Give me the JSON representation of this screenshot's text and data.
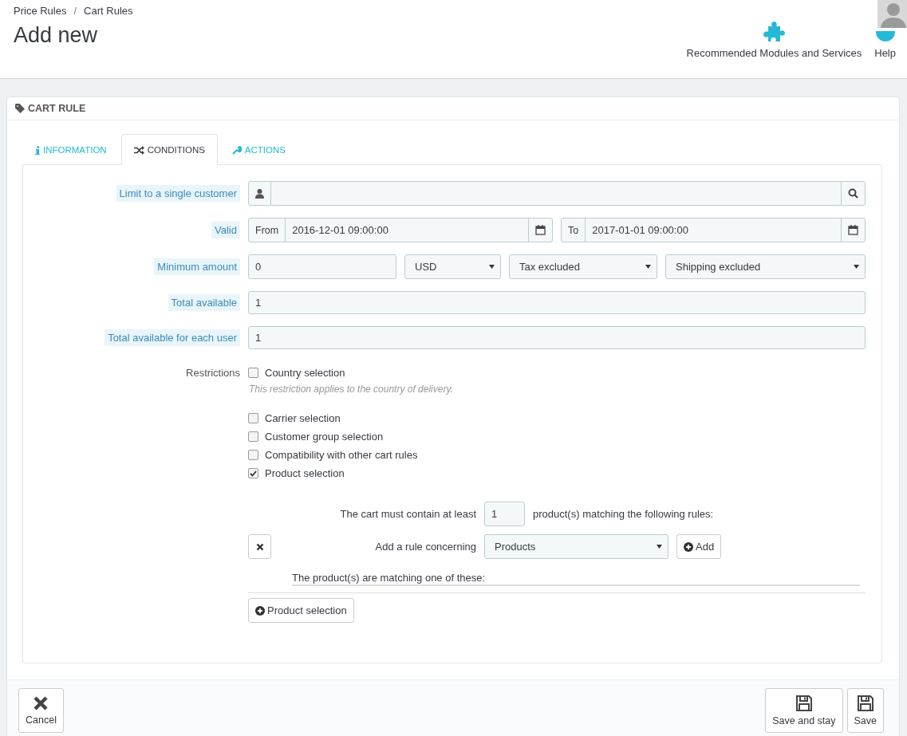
{
  "breadcrumb": {
    "items": [
      "Price Rules",
      "Cart Rules"
    ],
    "separator": "/"
  },
  "page_title": "Add new",
  "toolbar": [
    {
      "label": "Recommended Modules and Services",
      "kind": "modules"
    },
    {
      "label": "Help",
      "kind": "help"
    }
  ],
  "panel_title": "CART RULE",
  "tabs": [
    {
      "label": "INFORMATION",
      "selected": false
    },
    {
      "label": "CONDITIONS",
      "selected": true
    },
    {
      "label": "ACTIONS",
      "selected": false
    }
  ],
  "rows": [
    {
      "kind": "search",
      "label": "Limit to a single customer"
    },
    {
      "kind": "dates",
      "label": "Valid",
      "from": {
        "prefix": "From",
        "value": "2016-12-01 09:00:00"
      },
      "to": {
        "prefix": "To",
        "value": "2017-01-01 09:00:00"
      }
    },
    {
      "kind": "amount",
      "label": "Minimum amount",
      "value": "0",
      "selects": [
        "USD",
        "Tax excluded",
        "Shipping excluded"
      ]
    },
    {
      "kind": "text",
      "label": "Total available",
      "value": "1"
    },
    {
      "kind": "text",
      "label": "Total available for each user",
      "value": "1"
    }
  ],
  "restrictions": {
    "label": "Restrictions",
    "items": [
      {
        "label": "Country selection",
        "checked": false,
        "hint": "This restriction applies to the country of delivery."
      },
      {
        "label": "Carrier selection",
        "checked": false
      },
      {
        "label": "Customer group selection",
        "checked": false
      },
      {
        "label": "Compatibility with other cart rules",
        "checked": false
      },
      {
        "label": "Product selection",
        "checked": true
      }
    ]
  },
  "product_rules": {
    "before": "The cart must contain at least",
    "quantity": "1",
    "after": "product(s) matching the following rules:",
    "rule_label": "Add a rule concerning",
    "rule_select": "Products",
    "add_button": "Add",
    "matching_text": "The product(s) are matching one of these:",
    "group_button": "Product selection"
  },
  "footer": [
    {
      "label": "Cancel",
      "kind": "cancel"
    },
    {
      "label": "Save and stay",
      "kind": "save"
    },
    {
      "label": "Save",
      "kind": "save"
    }
  ]
}
